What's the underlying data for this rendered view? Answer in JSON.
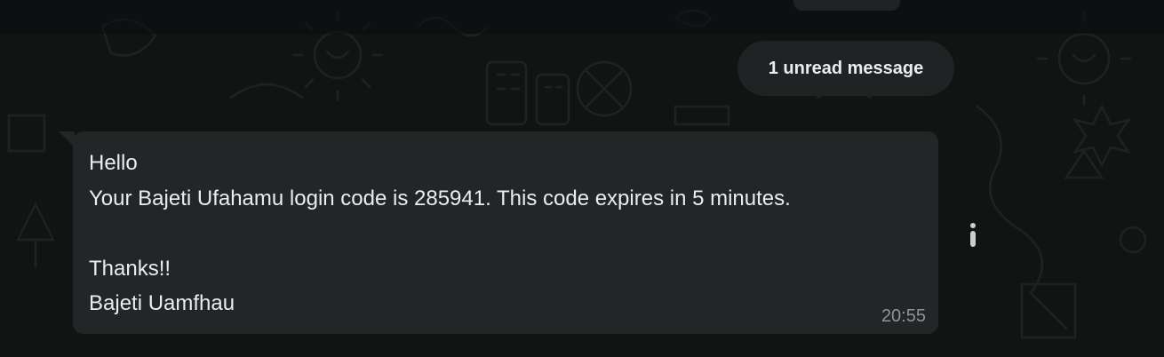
{
  "chat": {
    "unread_indicator": "1 unread message",
    "message": {
      "lines": [
        "Hello",
        "Your Bajeti Ufahamu login code is 285941. This code expires in 5 minutes.",
        "",
        "Thanks!!",
        "Bajeti Uamfhau"
      ],
      "time": "20:55"
    }
  },
  "icons": {
    "message_menu": "vertical-ellipsis-icon"
  },
  "colors": {
    "background": "#121414",
    "bubble": "#232626",
    "text": "#e9edef",
    "timestamp": "#8d9598"
  }
}
